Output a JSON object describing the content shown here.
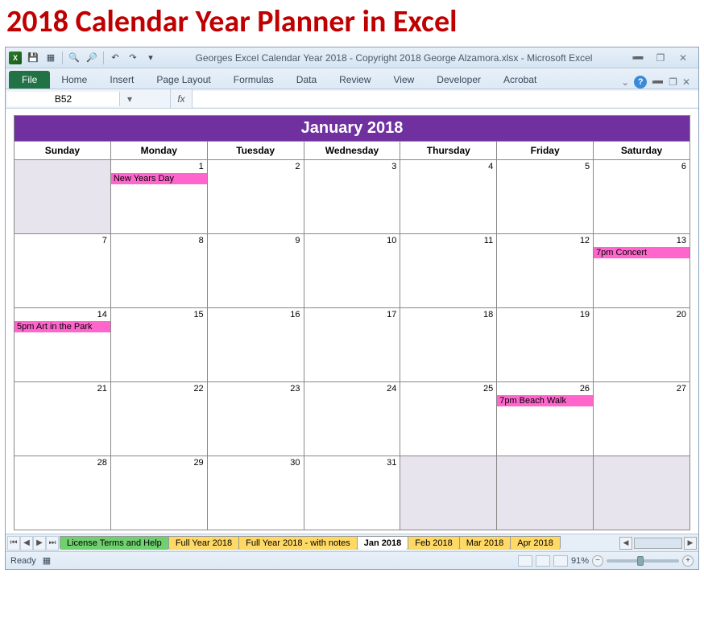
{
  "page_title": "2018 Calendar Year Planner in Excel",
  "window_title": "Georges Excel Calendar Year 2018  -  Copyright 2018 George Alzamora.xlsx  -  Microsoft Excel",
  "ribbon": {
    "file": "File",
    "tabs": [
      "Home",
      "Insert",
      "Page Layout",
      "Formulas",
      "Data",
      "Review",
      "View",
      "Developer",
      "Acrobat"
    ]
  },
  "name_box": "B52",
  "fx_label": "fx",
  "calendar": {
    "title": "January 2018",
    "days": [
      "Sunday",
      "Monday",
      "Tuesday",
      "Wednesday",
      "Thursday",
      "Friday",
      "Saturday"
    ],
    "weeks": [
      [
        {
          "n": "",
          "g": true
        },
        {
          "n": "1",
          "e": "New Years Day"
        },
        {
          "n": "2"
        },
        {
          "n": "3"
        },
        {
          "n": "4"
        },
        {
          "n": "5"
        },
        {
          "n": "6"
        }
      ],
      [
        {
          "n": "7"
        },
        {
          "n": "8"
        },
        {
          "n": "9"
        },
        {
          "n": "10"
        },
        {
          "n": "11"
        },
        {
          "n": "12"
        },
        {
          "n": "13",
          "e": "7pm Concert"
        }
      ],
      [
        {
          "n": "14",
          "e": "5pm Art in the Park"
        },
        {
          "n": "15"
        },
        {
          "n": "16"
        },
        {
          "n": "17"
        },
        {
          "n": "18"
        },
        {
          "n": "19"
        },
        {
          "n": "20"
        }
      ],
      [
        {
          "n": "21"
        },
        {
          "n": "22"
        },
        {
          "n": "23"
        },
        {
          "n": "24"
        },
        {
          "n": "25"
        },
        {
          "n": "26",
          "e": "7pm Beach Walk"
        },
        {
          "n": "27"
        }
      ],
      [
        {
          "n": "28"
        },
        {
          "n": "29"
        },
        {
          "n": "30"
        },
        {
          "n": "31"
        },
        {
          "n": "",
          "g": true
        },
        {
          "n": "",
          "g": true
        },
        {
          "n": "",
          "g": true
        }
      ]
    ]
  },
  "sheet_tabs": [
    {
      "label": "License Terms and Help",
      "cls": "st-green"
    },
    {
      "label": "Full Year 2018",
      "cls": "st-yellow"
    },
    {
      "label": "Full Year 2018 - with notes",
      "cls": "st-yellow"
    },
    {
      "label": "Jan 2018",
      "cls": "st-active"
    },
    {
      "label": "Feb 2018",
      "cls": "st-yellow"
    },
    {
      "label": "Mar 2018",
      "cls": "st-yellow"
    },
    {
      "label": "Apr 2018",
      "cls": "st-yellow"
    }
  ],
  "status": {
    "ready": "Ready",
    "zoom": "91%"
  }
}
